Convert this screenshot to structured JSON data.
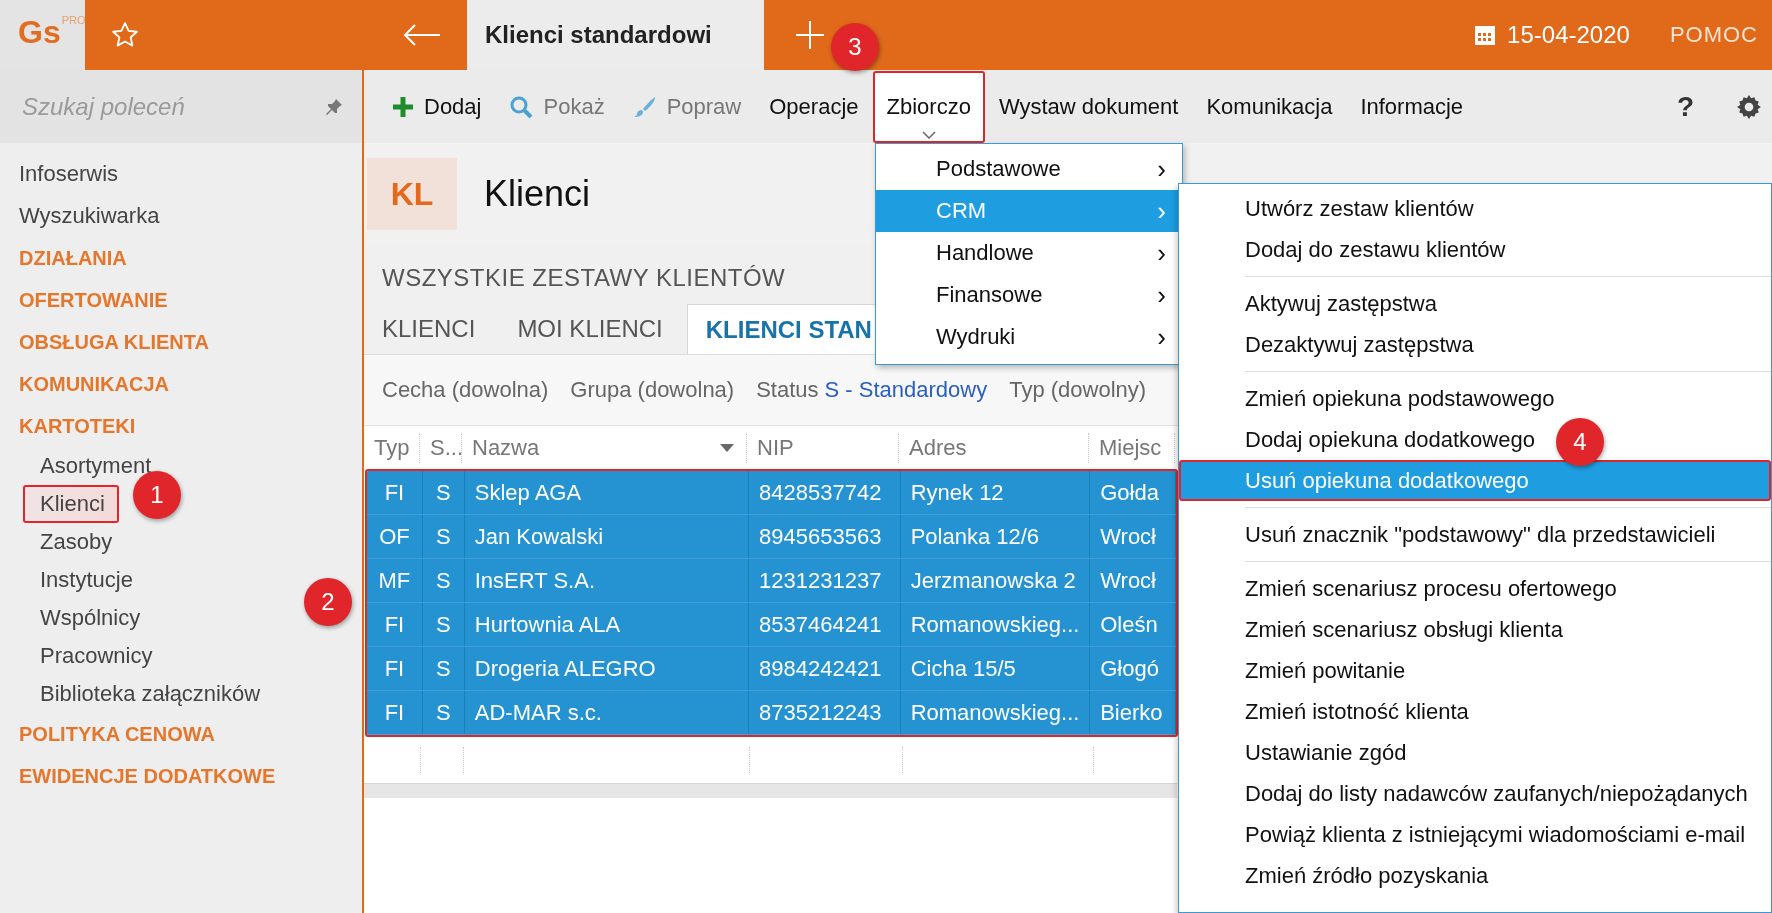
{
  "topbar": {
    "logo": "Gs",
    "logo_sup": "PRO",
    "tab": "Klienci standardowi",
    "date": "15-04-2020",
    "help": "POMOC"
  },
  "sidebar": {
    "search": {
      "placeholder": "Szukaj poleceń"
    },
    "items": [
      {
        "label": "Infoserwis",
        "kind": "link"
      },
      {
        "label": "Wyszukiwarka",
        "kind": "link"
      },
      {
        "label": "DZIAŁANIA",
        "kind": "section"
      },
      {
        "label": "OFERTOWANIE",
        "kind": "section"
      },
      {
        "label": "OBSŁUGA KLIENTA",
        "kind": "section"
      },
      {
        "label": "KOMUNIKACJA",
        "kind": "section"
      },
      {
        "label": "KARTOTEKI",
        "kind": "section",
        "children": [
          {
            "label": "Asortyment",
            "selected": false
          },
          {
            "label": "Klienci",
            "selected": true
          },
          {
            "label": "Zasoby",
            "selected": false
          },
          {
            "label": "Instytucje",
            "selected": false
          },
          {
            "label": "Wspólnicy",
            "selected": false
          },
          {
            "label": "Pracownicy",
            "selected": false
          },
          {
            "label": "Biblioteka załączników",
            "selected": false
          }
        ]
      },
      {
        "label": "POLITYKA CENOWA",
        "kind": "section"
      },
      {
        "label": "EWIDENCJE DODATKOWE",
        "kind": "section"
      }
    ]
  },
  "toolbar": {
    "items": [
      {
        "label": "Dodaj",
        "kind": "add",
        "disabled": false,
        "open": false
      },
      {
        "label": "Pokaż",
        "kind": "search",
        "disabled": true,
        "open": false
      },
      {
        "label": "Popraw",
        "kind": "edit",
        "disabled": true,
        "open": false
      },
      {
        "label": "Operacje",
        "kind": "text",
        "disabled": false,
        "open": false
      },
      {
        "label": "Zbiorczo",
        "kind": "text",
        "disabled": false,
        "open": true
      },
      {
        "label": "Wystaw dokument",
        "kind": "text",
        "disabled": false,
        "open": false
      },
      {
        "label": "Komunikacja",
        "kind": "text",
        "disabled": false,
        "open": false
      },
      {
        "label": "Informacje",
        "kind": "text",
        "disabled": false,
        "open": false
      }
    ],
    "help": "?"
  },
  "header": {
    "badge": "KL",
    "title": "Klienci"
  },
  "sets": {
    "title": "WSZYSTKIE ZESTAWY KLIENTÓW",
    "tabs": [
      {
        "label": "KLIENCI",
        "selected": false
      },
      {
        "label": "MOI KLIENCI",
        "selected": false
      },
      {
        "label": "KLIENCI STAN",
        "selected": true
      }
    ]
  },
  "filters": [
    {
      "label": "Cecha (dowolna)"
    },
    {
      "label": "Grupa (dowolna)"
    },
    {
      "label": "Status",
      "value": "S - Standardowy"
    },
    {
      "label": "Typ (dowolny)"
    }
  ],
  "table": {
    "columns": [
      "Typ",
      "S...",
      "Nazwa",
      "NIP",
      "Adres",
      "Miejsc"
    ],
    "rows": [
      {
        "selected": true,
        "cells": [
          "FI",
          "S",
          "Sklep AGA",
          "8428537742",
          "Rynek 12",
          "Gołda"
        ]
      },
      {
        "selected": true,
        "cells": [
          "OF",
          "S",
          "Jan Kowalski",
          "8945653563",
          "Polanka  12/6",
          "Wrocł"
        ]
      },
      {
        "selected": true,
        "cells": [
          "MF",
          "S",
          "InsERT S.A.",
          "1231231237",
          "Jerzmanowska 2",
          "Wrocł"
        ]
      },
      {
        "selected": true,
        "cells": [
          "FI",
          "S",
          "Hurtownia ALA",
          "8537464241",
          "Romanowskieg...",
          "Oleśn"
        ]
      },
      {
        "selected": true,
        "cells": [
          "FI",
          "S",
          "Drogeria ALEGRO",
          "8984242421",
          "Cicha  15/5",
          "Głogó"
        ]
      },
      {
        "selected": true,
        "cells": [
          "FI",
          "S",
          "AD-MAR s.c.",
          "8735212243",
          "Romanowskieg...",
          "Bierko"
        ]
      }
    ]
  },
  "menu": {
    "items": [
      {
        "label": "Podstawowe",
        "selected": false,
        "arrow": "›"
      },
      {
        "label": "CRM",
        "selected": true,
        "arrow": "›"
      },
      {
        "label": "Handlowe",
        "selected": false,
        "arrow": "›"
      },
      {
        "label": "Finansowe",
        "selected": false,
        "arrow": "›"
      },
      {
        "label": "Wydruki",
        "selected": false,
        "arrow": "›"
      }
    ]
  },
  "submenu": {
    "sections": [
      {
        "items": [
          {
            "label": "Utwórz zestaw klientów",
            "selected": false
          },
          {
            "label": "Dodaj do zestawu klientów",
            "selected": false
          }
        ]
      },
      {
        "items": [
          {
            "label": "Aktywuj zastępstwa",
            "selected": false
          },
          {
            "label": "Dezaktywuj zastępstwa",
            "selected": false
          }
        ]
      },
      {
        "items": [
          {
            "label": "Zmień opiekuna podstawowego",
            "selected": false
          },
          {
            "label": "Dodaj opiekuna dodatkowego",
            "selected": false
          },
          {
            "label": "Usuń opiekuna dodatkowego",
            "selected": true
          }
        ]
      },
      {
        "items": [
          {
            "label": "Usuń znacznik \"podstawowy\" dla przedstawicieli",
            "selected": false
          }
        ]
      },
      {
        "items": [
          {
            "label": "Zmień scenariusz procesu ofertowego",
            "selected": false
          },
          {
            "label": "Zmień scenariusz obsługi klienta",
            "selected": false
          },
          {
            "label": "Zmień powitanie",
            "selected": false
          },
          {
            "label": "Zmień istotność klienta",
            "selected": false
          },
          {
            "label": "Ustawianie zgód",
            "selected": false
          },
          {
            "label": "Dodaj do listy nadawców zaufanych/niepożądanych",
            "selected": false
          },
          {
            "label": "Powiąż klienta z istniejącymi wiadomościami e-mail",
            "selected": false
          },
          {
            "label": "Zmień źródło pozyskania",
            "selected": false
          }
        ]
      }
    ]
  },
  "callouts": [
    "1",
    "2",
    "3",
    "4"
  ]
}
